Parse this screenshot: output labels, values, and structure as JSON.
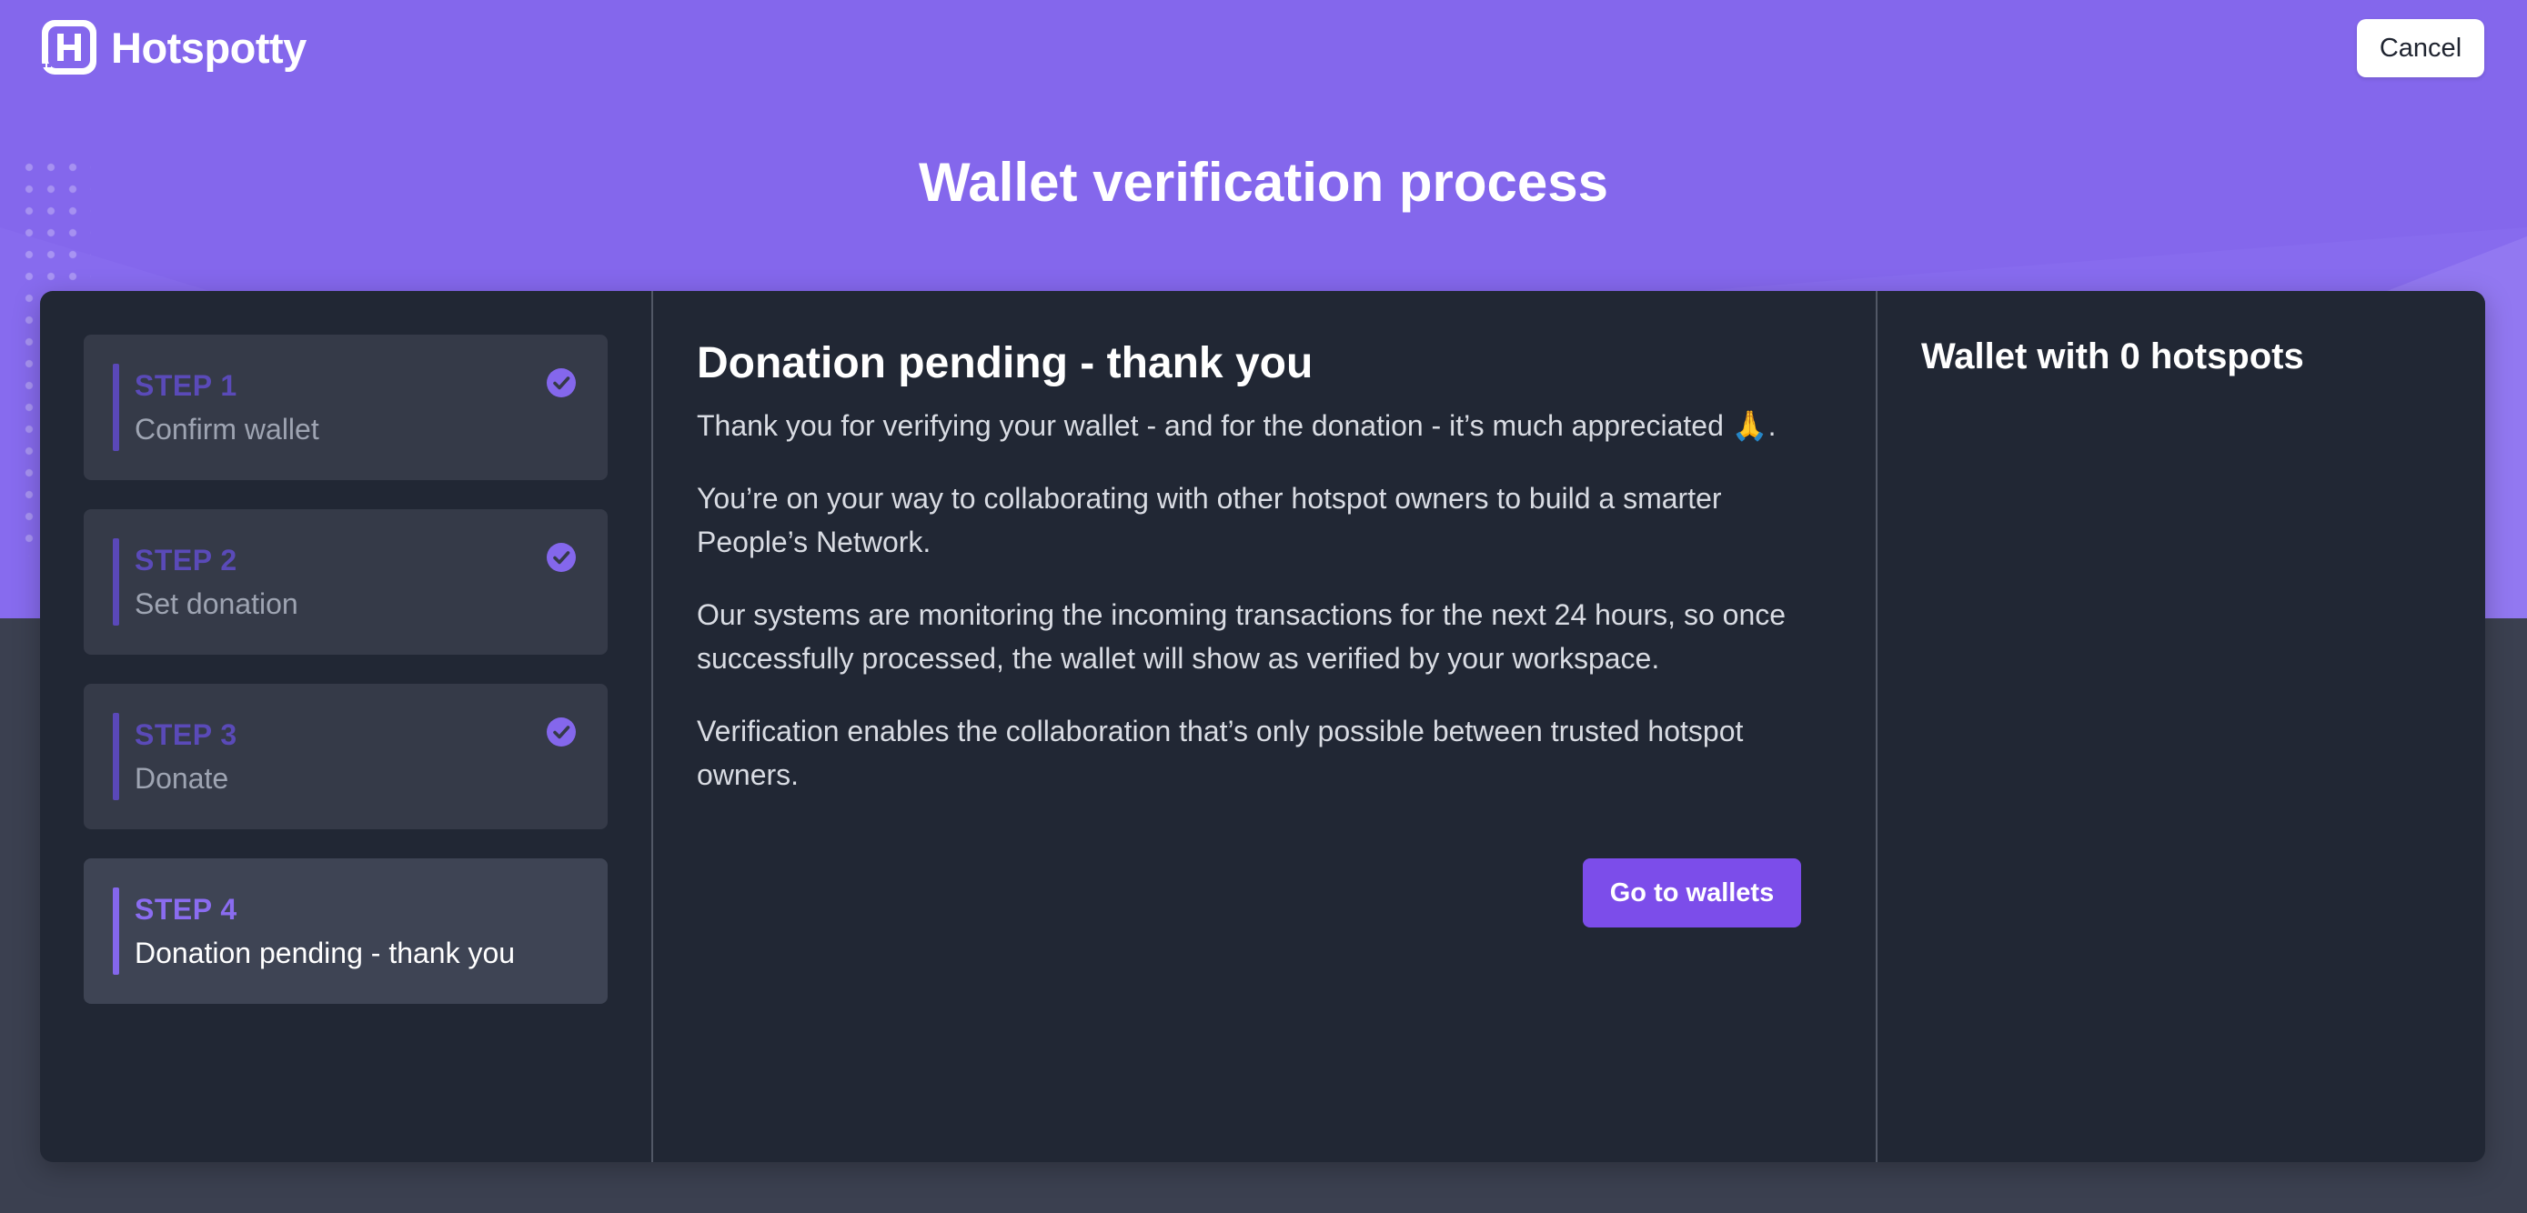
{
  "header": {
    "logo_text": "Hotspotty",
    "logo_letter": "H",
    "cancel_label": "Cancel"
  },
  "page_title": "Wallet verification process",
  "steps": [
    {
      "number": "STEP 1",
      "label": "Confirm wallet",
      "status": "completed"
    },
    {
      "number": "STEP 2",
      "label": "Set donation",
      "status": "completed"
    },
    {
      "number": "STEP 3",
      "label": "Donate",
      "status": "completed"
    },
    {
      "number": "STEP 4",
      "label": "Donation pending - thank you",
      "status": "current"
    }
  ],
  "main": {
    "title": "Donation pending - thank you",
    "paragraphs": [
      "Thank you for verifying your wallet - and for the donation - it’s much appreciated 🙏.",
      "You’re on your way to collaborating with other hotspot owners to build a smarter People’s Network.",
      "Our systems are monitoring the incoming transactions for the next 24 hours, so once successfully processed, the wallet will show as verified by your workspace.",
      "Verification enables the collaboration that’s only possible between trusted hotspot owners."
    ],
    "go_button_label": "Go to wallets"
  },
  "side": {
    "title": "Wallet with 0 hotspots"
  },
  "icons": {
    "logo": "hotspotty-logo-icon",
    "step_done": "check-circle-icon"
  },
  "colors": {
    "hero_bg": "#8467ec",
    "page_bg": "#3b4050",
    "card_bg": "#212734",
    "accent": "#7c4dea",
    "step_bg": "#353a48",
    "check": "#8467ec"
  }
}
